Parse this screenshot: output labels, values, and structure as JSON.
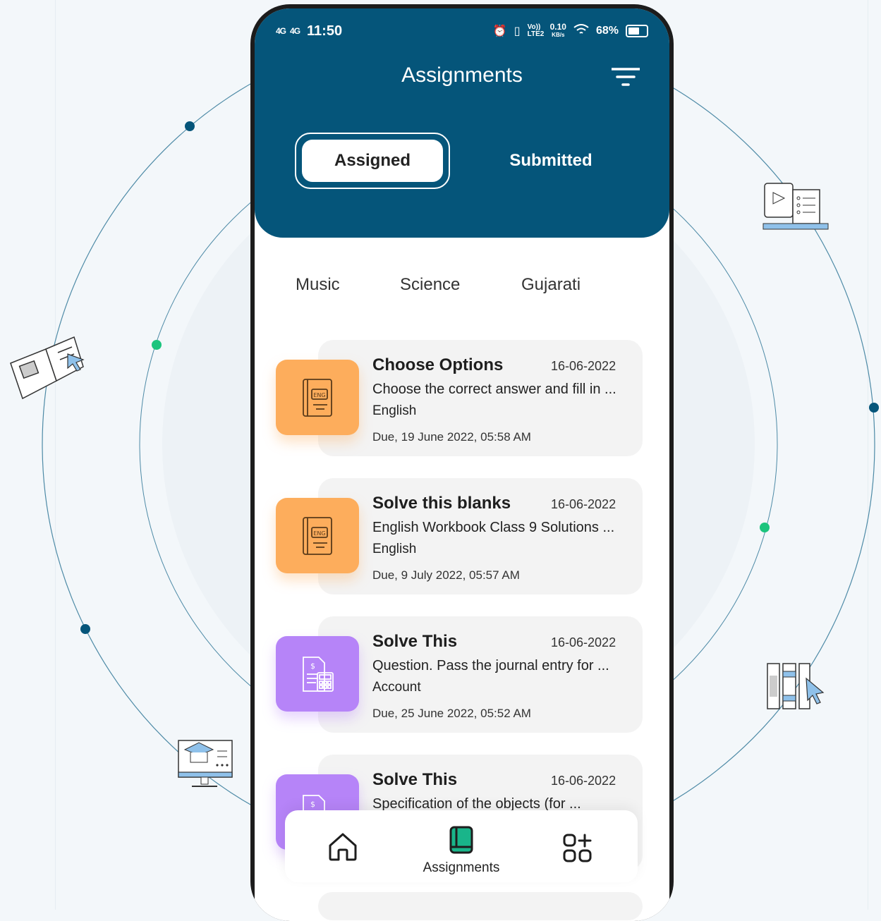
{
  "status_bar": {
    "network1": "4G",
    "network2": "4G",
    "time": "11:50",
    "volte": "Vo)) LTE2",
    "speed": "0.10",
    "speed_unit": "KB/s",
    "battery": "68%"
  },
  "header": {
    "title": "Assignments",
    "filter_icon": "filter-icon"
  },
  "tabs": {
    "assigned": "Assigned",
    "submitted": "Submitted"
  },
  "subjects": [
    "Music",
    "Science",
    "Gujarati"
  ],
  "assignments": [
    {
      "title": "Choose Options",
      "date": "16-06-2022",
      "description": "Choose the correct answer and fill in ...",
      "subject": "English",
      "due": "Due, 19 June 2022, 05:58 AM",
      "icon": "english-book-icon",
      "color": "#fdad5c"
    },
    {
      "title": "Solve this blanks",
      "date": "16-06-2022",
      "description": "English Workbook Class 9 Solutions ...",
      "subject": "English",
      "due": "Due, 9 July 2022, 05:57 AM",
      "icon": "english-book-icon",
      "color": "#fdad5c"
    },
    {
      "title": "Solve This",
      "date": "16-06-2022",
      "description": "Question. Pass the journal entry for ...",
      "subject": "Account",
      "due": "Due, 25 June 2022, 05:52 AM",
      "icon": "accounting-calculator-icon",
      "color": "#b684f8"
    },
    {
      "title": "Solve This",
      "date": "16-06-2022",
      "description": "Specification of the objects (for ...",
      "icon": "accounting-calculator-icon",
      "color": "#b684f8"
    }
  ],
  "bottom_nav": {
    "home_icon": "home-icon",
    "assignments_label": "Assignments",
    "assignments_icon": "book-icon",
    "more_icon": "apps-add-icon"
  },
  "colors": {
    "header": "#05557a",
    "active_nav": "#19b58a",
    "accent_dot_dark": "#05557a",
    "accent_dot_green": "#1bc47d"
  }
}
